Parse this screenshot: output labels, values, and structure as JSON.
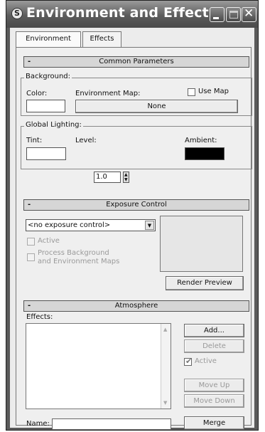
{
  "window": {
    "title": "Environment and Effects",
    "app_icon_glyph": "S"
  },
  "tabs": [
    {
      "label": "Environment"
    },
    {
      "label": "Effects"
    }
  ],
  "common_parameters": {
    "header": "Common Parameters",
    "collapse_sign": "-",
    "background": {
      "group_label": "Background:",
      "color_label": "Color:",
      "color_value": "#ffffff",
      "env_map_label": "Environment Map:",
      "use_map_label": "Use Map",
      "use_map_checked": false,
      "map_button": "None"
    },
    "global_lighting": {
      "group_label": "Global Lighting:",
      "tint_label": "Tint:",
      "tint_value": "#ffffff",
      "level_label": "Level:",
      "level_value": "1.0",
      "ambient_label": "Ambient:",
      "ambient_value": "#000000"
    }
  },
  "exposure_control": {
    "header": "Exposure Control",
    "collapse_sign": "-",
    "selected": "<no exposure control>",
    "active_label": "Active",
    "active_checked": false,
    "process_bg_label_line1": "Process Background",
    "process_bg_label_line2": "and Environment Maps",
    "process_bg_checked": false,
    "render_preview_button": "Render Preview"
  },
  "atmosphere": {
    "header": "Atmosphere",
    "collapse_sign": "-",
    "effects_label": "Effects:",
    "effects": [],
    "add_button": "Add...",
    "delete_button": "Delete",
    "active_label": "Active",
    "active_checked": true,
    "move_up_button": "Move Up",
    "move_down_button": "Move Down",
    "name_label": "Name:",
    "name_value": "",
    "merge_button": "Merge"
  },
  "colors": {
    "title_bar": "#5c5c5c",
    "panel_bg": "#efefef"
  }
}
